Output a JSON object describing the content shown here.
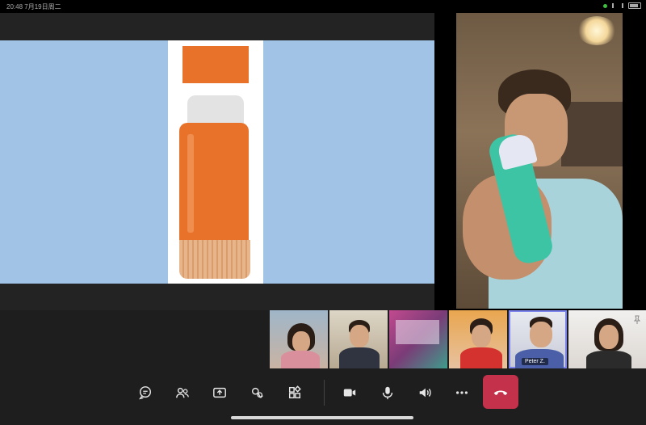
{
  "status_bar": {
    "time": "20:48",
    "date": "7月19日周二"
  },
  "participants": [
    {
      "name": ""
    },
    {
      "name": ""
    },
    {
      "name": ""
    },
    {
      "name": ""
    },
    {
      "name": "Peter Z."
    },
    {
      "name": ""
    }
  ],
  "controls": {
    "icons": [
      "chat-icon",
      "people-icon",
      "share-icon",
      "raise-hand-icon",
      "apps-icon",
      "camera-icon",
      "microphone-icon",
      "speaker-icon",
      "more-icon",
      "hang-up-icon"
    ]
  },
  "colors": {
    "hangup": "#c4314b",
    "active_speaker": "#7b83eb",
    "slide_background": "#a0c3e6",
    "glue_stick": "#e9722a"
  }
}
